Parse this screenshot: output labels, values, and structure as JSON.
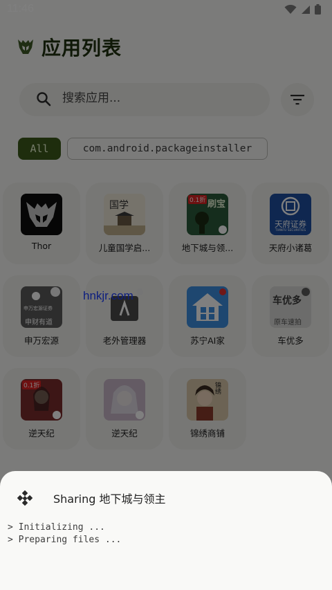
{
  "status": {
    "time": "11:46"
  },
  "header": {
    "title": "应用列表"
  },
  "search": {
    "placeholder": "搜索应用..."
  },
  "filters": {
    "all_label": "All",
    "package_label": "com.android.packageinstaller"
  },
  "apps": [
    {
      "label": "Thor",
      "icon": "thor-helmet-icon"
    },
    {
      "label": "儿童国学启...",
      "icon": "guoxue-icon",
      "icon_text": "国学"
    },
    {
      "label": "地下城与领...",
      "icon": "dungeon-icon",
      "icon_text": "刷宝",
      "badge": "0.1折"
    },
    {
      "label": "天府小诸葛",
      "icon": "tianfu-securities-icon",
      "icon_text": "天府证券",
      "icon_subtext": "TIANFU SECURITIES"
    },
    {
      "label": "申万宏源",
      "icon": "shenwan-icon",
      "icon_text": "申万宏源证券",
      "icon_subtext": "申财有道"
    },
    {
      "label": "老外管理器",
      "icon": "laowai-manager-icon"
    },
    {
      "label": "苏宁AI家",
      "icon": "suning-home-icon"
    },
    {
      "label": "车优多",
      "icon": "cheyouduo-icon",
      "icon_text": "车优多",
      "icon_subtext": "原车速拍"
    },
    {
      "label": "逆天纪",
      "icon": "nitianji-icon-1",
      "badge": "0.1折"
    },
    {
      "label": "逆天纪",
      "icon": "nitianji-icon-2"
    },
    {
      "label": "锦绣商铺",
      "icon": "jinxiu-shop-icon",
      "icon_text": "锦绣"
    }
  ],
  "sheet": {
    "title": "Sharing 地下城与领主",
    "log_lines": [
      "> Initializing ...",
      "> Preparing files ..."
    ]
  },
  "watermark": "hnkjr.com",
  "colors": {
    "accent": "#3c5a1b",
    "title": "#203311",
    "background": "#f7f7f5"
  }
}
